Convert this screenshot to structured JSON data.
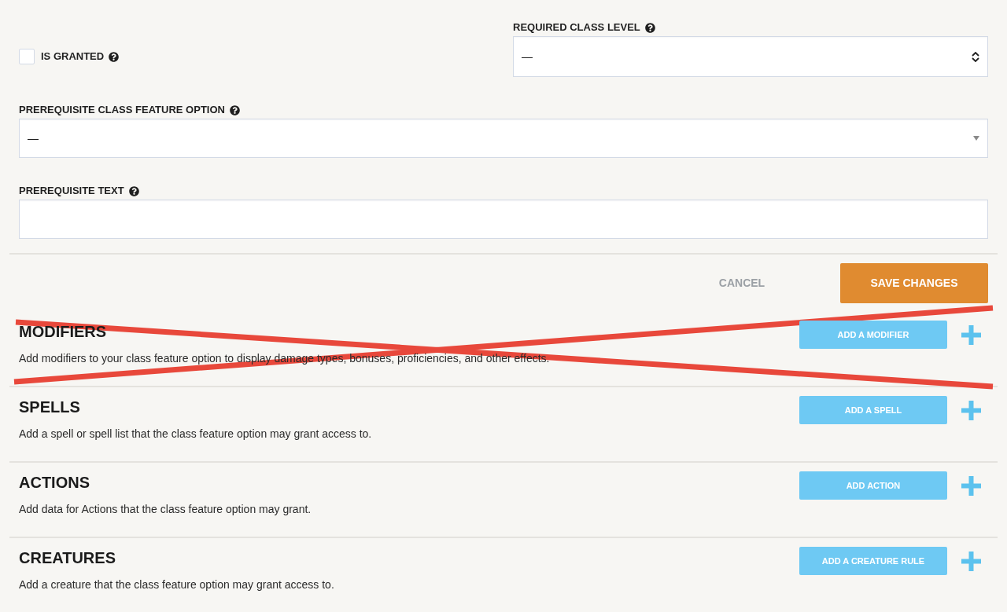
{
  "is_granted": {
    "label": "IS GRANTED",
    "checked": false
  },
  "required_class_level": {
    "label": "REQUIRED CLASS LEVEL",
    "value": "—"
  },
  "prerequisite_class_feature_option": {
    "label": "PREREQUISITE CLASS FEATURE OPTION",
    "value": "—"
  },
  "prerequisite_text": {
    "label": "PREREQUISITE TEXT"
  },
  "form_actions": {
    "cancel": "CANCEL",
    "save": "SAVE CHANGES"
  },
  "sections": [
    {
      "title": "MODIFIERS",
      "description": "Add modifiers to your class feature option to display damage types, bonuses, proficiencies, and other effects.",
      "button": "ADD A MODIFIER"
    },
    {
      "title": "SPELLS",
      "description": "Add a spell or spell list that the class feature option may grant access to.",
      "button": "ADD A SPELL"
    },
    {
      "title": "ACTIONS",
      "description": "Add data for Actions that the class feature option may grant.",
      "button": "ADD ACTION"
    },
    {
      "title": "CREATURES",
      "description": "Add a creature that the class feature option may grant access to.",
      "button": "ADD A CREATURE RULE"
    }
  ]
}
